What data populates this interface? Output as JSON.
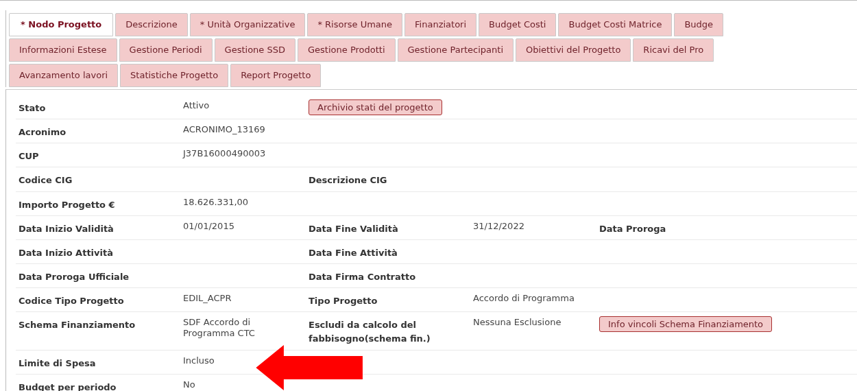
{
  "tab_rows": [
    {
      "tabs": [
        {
          "label": "* Nodo Progetto",
          "selected": true
        },
        {
          "label": "Descrizione",
          "selected": false
        },
        {
          "label": "* Unità Organizzative",
          "selected": false
        },
        {
          "label": "* Risorse Umane",
          "selected": false
        },
        {
          "label": "Finanziatori",
          "selected": false
        },
        {
          "label": "Budget Costi",
          "selected": false
        },
        {
          "label": "Budget Costi Matrice",
          "selected": false
        },
        {
          "label": "Budge",
          "selected": false
        }
      ]
    },
    {
      "tabs": [
        {
          "label": "Informazioni Estese",
          "selected": false
        },
        {
          "label": "Gestione Periodi",
          "selected": false
        },
        {
          "label": "Gestione SSD",
          "selected": false
        },
        {
          "label": "Gestione Prodotti",
          "selected": false
        },
        {
          "label": "Gestione Partecipanti",
          "selected": false
        },
        {
          "label": "Obiettivi del Progetto",
          "selected": false
        },
        {
          "label": "Ricavi del Pro",
          "selected": false
        }
      ]
    },
    {
      "tabs": [
        {
          "label": "Avanzamento lavori",
          "selected": false
        },
        {
          "label": "Statistiche Progetto",
          "selected": false
        },
        {
          "label": "Report Progetto",
          "selected": false
        }
      ]
    }
  ],
  "rows": [
    {
      "label": "Stato",
      "value": "Attivo",
      "button": "Archivio stati del progetto"
    },
    {
      "label": "Acronimo",
      "value": "ACRONIMO_13169"
    },
    {
      "label": "CUP",
      "value": "J37B16000490003"
    },
    {
      "label": "Codice CIG",
      "label_2": "Descrizione CIG"
    },
    {
      "label": "Importo Progetto €",
      "value": "18.626.331,00"
    },
    {
      "label": "Data Inizio Validità",
      "value": "01/01/2015",
      "label_2": "Data Fine Validità",
      "value_2": "31/12/2022",
      "label_3": "Data Proroga"
    },
    {
      "label": "Data Inizio Attività",
      "label_2": "Data Fine Attività"
    },
    {
      "label": "Data Proroga Ufficiale",
      "label_2": "Data Firma Contratto"
    },
    {
      "label": "Codice Tipo Progetto",
      "value": "EDIL_ACPR",
      "label_2": "Tipo Progetto",
      "value_2": "Accordo di Programma"
    },
    {
      "label": "Schema Finanziamento",
      "value": "SDF Accordo di Programma CTC",
      "label_2": "Escludi da calcolo del fabbisogno(schema fin.)",
      "value_2": "Nessuna Esclusione",
      "button": "Info vincoli Schema Finanziamento"
    },
    {
      "label": "Limite di Spesa",
      "value": "Incluso"
    },
    {
      "label": "Budget per periodo",
      "value": "No"
    }
  ]
}
